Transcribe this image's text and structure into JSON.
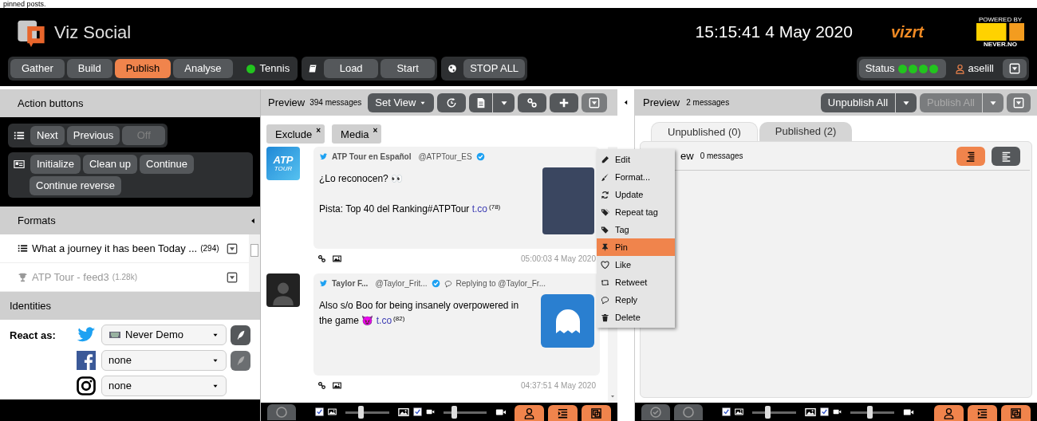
{
  "caption": "pinned posts.",
  "header": {
    "app_name": "Viz Social",
    "clock": "15:15:41 4 May 2020",
    "vizrt": "vizrt",
    "powered_by": "POWERED BY",
    "never_no": "NEVER.NO"
  },
  "nav": {
    "tabs": [
      {
        "label": "Gather",
        "selected": false
      },
      {
        "label": "Build",
        "selected": false
      },
      {
        "label": "Publish",
        "selected": true
      },
      {
        "label": "Analyse",
        "selected": false
      }
    ],
    "channel": {
      "label": "Tennis",
      "color": "#22c51e"
    },
    "buttons": [
      "Load",
      "Start"
    ],
    "stop_all": "STOP ALL",
    "status": {
      "label": "Status",
      "dots": [
        {
          "color": "#22c51e"
        },
        {
          "color": "#22c51e"
        },
        {
          "color": "#22c51e"
        },
        {
          "color": "#22c51e"
        }
      ]
    },
    "user": "aselill"
  },
  "left": {
    "action_title": "Action buttons",
    "row1": [
      {
        "label": "Next",
        "disabled": false
      },
      {
        "label": "Previous",
        "disabled": false
      },
      {
        "label": "Off",
        "disabled": true
      }
    ],
    "row2": [
      {
        "label": "Initialize",
        "disabled": false
      },
      {
        "label": "Clean up",
        "disabled": false
      },
      {
        "label": "Continue",
        "disabled": false
      },
      {
        "label": "Continue reverse",
        "disabled": false
      }
    ],
    "formats_title": "Formats",
    "formats": [
      {
        "kind": "list",
        "title": "What a journey it has been Today ...",
        "count": "(294)",
        "dimmed": false
      },
      {
        "kind": "trophy",
        "title": "ATP Tour - feed3",
        "count": "(1.28k)",
        "dimmed": true
      }
    ],
    "identities_title": "Identities",
    "react_label": "React as:",
    "identities": [
      {
        "kind": "twitter",
        "value": "Never Demo",
        "has_account_icon": true,
        "compose": {
          "disabled": false
        }
      },
      {
        "kind": "facebook",
        "value": "none",
        "has_account_icon": false,
        "compose": {
          "disabled": true
        }
      },
      {
        "kind": "instagram",
        "value": "none",
        "has_account_icon": false
      }
    ]
  },
  "middle": {
    "title": "Preview",
    "count": "394 messages",
    "set_view": "Set View",
    "filters": [
      {
        "label": "Exclude",
        "close": "×"
      },
      {
        "label": "Media",
        "close": "×"
      }
    ],
    "posts": [
      {
        "avatar": {
          "kind": "logo",
          "lines": [
            "ATP",
            "TOUR"
          ]
        },
        "name": "ATP Tour en Español",
        "handle": "@ATPTour_ES",
        "lines": [
          "¿Lo reconocen? 👀",
          "Pista: Top 40 del Ranking#ATPTour"
        ],
        "link": "t.co",
        "link_count": "(78)",
        "photo": {
          "kind": "portrait"
        },
        "time": "05:00:03 4 May 2020"
      },
      {
        "avatar": {
          "kind": "person"
        },
        "name": "Taylor F...",
        "handle": "@Taylor_Frit...",
        "replying": "Replying to @Taylor_Fr...",
        "lines": [
          "Also s/o Boo for being insanely overpowered in the game 😈"
        ],
        "link": "t.co",
        "link_count": "(82)",
        "photo": {
          "kind": "game"
        },
        "time": "04:37:51 4 May 2020"
      }
    ],
    "bottom": {
      "image": {
        "checked": true,
        "level": 0.35
      },
      "video": {
        "checked": true,
        "level": 0.25
      }
    }
  },
  "menu": [
    {
      "kind": "pencil",
      "label": "Edit",
      "selected": false
    },
    {
      "kind": "brush",
      "label": "Format...",
      "selected": false
    },
    {
      "kind": "refresh",
      "label": "Update",
      "selected": false
    },
    {
      "kind": "tags",
      "label": "Repeat tag",
      "selected": false
    },
    {
      "kind": "tag",
      "label": "Tag",
      "selected": false
    },
    {
      "kind": "pin",
      "label": "Pin",
      "selected": true
    },
    {
      "kind": "heart",
      "label": "Like",
      "selected": false
    },
    {
      "kind": "retweet",
      "label": "Retweet",
      "selected": false
    },
    {
      "kind": "reply",
      "label": "Reply",
      "selected": false
    },
    {
      "kind": "trash",
      "label": "Delete",
      "selected": false
    }
  ],
  "right": {
    "title": "Preview",
    "count": "2 messages",
    "unpublish_all": "Unpublish All",
    "publish_all": "Publish All",
    "tabs": [
      {
        "label": "Unpublished (0)",
        "selected": true
      },
      {
        "label": "Published (2)",
        "selected": false
      }
    ],
    "inner_label": "ew",
    "inner_count": "0 messages",
    "bottom": {
      "image": {
        "checked": true,
        "level": 0.35
      },
      "video": {
        "checked": true,
        "level": 0.45
      }
    }
  }
}
